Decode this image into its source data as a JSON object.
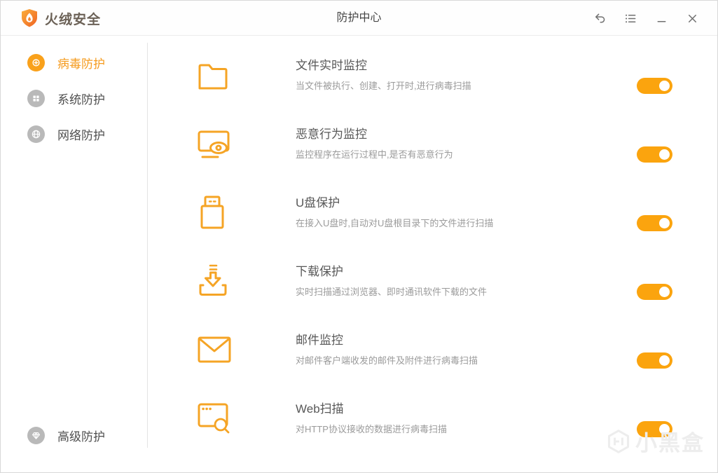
{
  "window": {
    "app_name": "火绒安全",
    "title": "防护中心",
    "controls": [
      "back",
      "log-list",
      "minimize",
      "close"
    ]
  },
  "colors": {
    "accent": "#F9A11B",
    "toggle_on": "#FBA40E",
    "inactive_icon_circle": "#B9B9B9",
    "selected_text": "#F59B1E",
    "row_title_text": "#585858",
    "row_desc_text": "#9B9B9B",
    "brand_text": "#6B6156"
  },
  "sidebar": {
    "items": [
      {
        "label": "病毒防护",
        "icon": "virus-protection-icon",
        "selected": true
      },
      {
        "label": "系统防护",
        "icon": "system-protection-icon",
        "selected": false
      },
      {
        "label": "网络防护",
        "icon": "network-protection-icon",
        "selected": false
      },
      {
        "label": "高级防护",
        "icon": "advanced-protection-icon",
        "selected": false
      }
    ]
  },
  "main": {
    "rows": [
      {
        "icon": "folder-icon",
        "title": "文件实时监控",
        "desc": "当文件被执行、创建、打开时,进行病毒扫描",
        "enabled": true
      },
      {
        "icon": "monitor-eye-icon",
        "title": "恶意行为监控",
        "desc": "监控程序在运行过程中,是否有恶意行为",
        "enabled": true
      },
      {
        "icon": "usb-drive-icon",
        "title": "U盘保护",
        "desc": "在接入U盘时,自动对U盘根目录下的文件进行扫描",
        "enabled": true
      },
      {
        "icon": "download-icon",
        "title": "下载保护",
        "desc": "实时扫描通过浏览器、即时通讯软件下载的文件",
        "enabled": true
      },
      {
        "icon": "mail-icon",
        "title": "邮件监控",
        "desc": "对邮件客户端收发的邮件及附件进行病毒扫描",
        "enabled": true
      },
      {
        "icon": "web-scan-icon",
        "title": "Web扫描",
        "desc": "对HTTP协议接收的数据进行病毒扫描",
        "enabled": true
      }
    ]
  },
  "watermark": {
    "text": "小黑盒"
  }
}
